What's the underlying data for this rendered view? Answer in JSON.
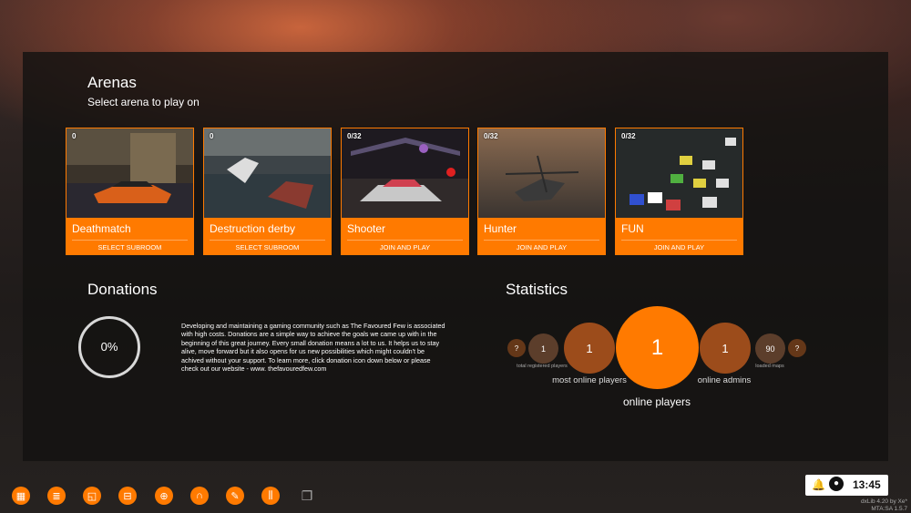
{
  "arenas_header": {
    "title": "Arenas",
    "subtitle": "Select arena to play on"
  },
  "arenas": [
    {
      "count": "0",
      "name": "Deathmatch",
      "action": "SELECT SUBROOM"
    },
    {
      "count": "0",
      "name": "Destruction derby",
      "action": "SELECT SUBROOM"
    },
    {
      "count": "0/32",
      "name": "Shooter",
      "action": "JOIN AND PLAY"
    },
    {
      "count": "0/32",
      "name": "Hunter",
      "action": "JOIN AND PLAY"
    },
    {
      "count": "0/32",
      "name": "FUN",
      "action": "JOIN AND PLAY"
    }
  ],
  "donations": {
    "title": "Donations",
    "percent": "0%",
    "text": "Developing and maintaining a gaming community such as The Favoured Few is associated with high costs.  Donations are a simple way to achieve the goals we came up with in the beginning of this great journey. Every small donation means a lot to us.  It helps us to stay alive, move forward but it also opens for us new possibilities which might couldn't be achived without your support. To learn more, click donation icon down below or please check out our website - www. thefavouredfew.com"
  },
  "statistics": {
    "title": "Statistics",
    "tiny_left": "?",
    "registered_value": "1",
    "registered_label": "total registered players",
    "most_online_value": "1",
    "most_online_label": "most online players",
    "online_value": "1",
    "online_label": "online players",
    "admins_value": "1",
    "admins_label": "online admins",
    "maps_value": "90",
    "maps_label": "loaded maps",
    "tiny_right": "?"
  },
  "taskbar": {
    "icons": [
      "arena-icon",
      "document-icon",
      "chart-icon",
      "car-icon",
      "globe-icon",
      "headphones-icon",
      "paint-icon",
      "sliders-icon",
      "windows-icon"
    ],
    "time": "13:45"
  },
  "version": {
    "line1": "dxLib 4.20 by Xe*",
    "line2": "MTA:SA 1.5.7"
  },
  "colors": {
    "accent": "#ff7a00"
  }
}
